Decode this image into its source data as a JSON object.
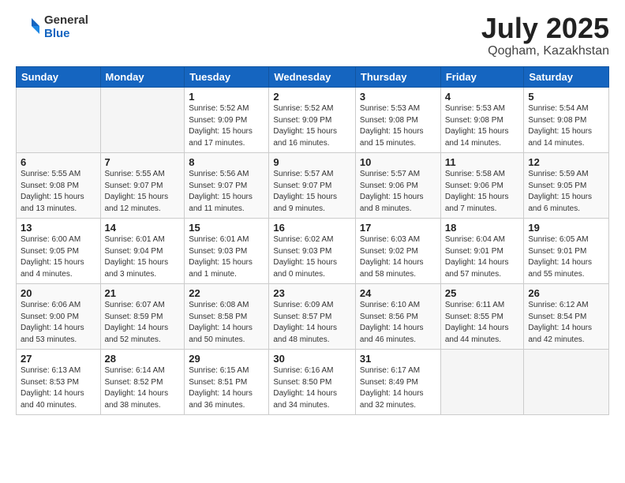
{
  "logo": {
    "general": "General",
    "blue": "Blue"
  },
  "header": {
    "month_year": "July 2025",
    "location": "Qogham, Kazakhstan"
  },
  "weekdays": [
    "Sunday",
    "Monday",
    "Tuesday",
    "Wednesday",
    "Thursday",
    "Friday",
    "Saturday"
  ],
  "weeks": [
    [
      {
        "day": "",
        "info": ""
      },
      {
        "day": "",
        "info": ""
      },
      {
        "day": "1",
        "info": "Sunrise: 5:52 AM\nSunset: 9:09 PM\nDaylight: 15 hours\nand 17 minutes."
      },
      {
        "day": "2",
        "info": "Sunrise: 5:52 AM\nSunset: 9:09 PM\nDaylight: 15 hours\nand 16 minutes."
      },
      {
        "day": "3",
        "info": "Sunrise: 5:53 AM\nSunset: 9:08 PM\nDaylight: 15 hours\nand 15 minutes."
      },
      {
        "day": "4",
        "info": "Sunrise: 5:53 AM\nSunset: 9:08 PM\nDaylight: 15 hours\nand 14 minutes."
      },
      {
        "day": "5",
        "info": "Sunrise: 5:54 AM\nSunset: 9:08 PM\nDaylight: 15 hours\nand 14 minutes."
      }
    ],
    [
      {
        "day": "6",
        "info": "Sunrise: 5:55 AM\nSunset: 9:08 PM\nDaylight: 15 hours\nand 13 minutes."
      },
      {
        "day": "7",
        "info": "Sunrise: 5:55 AM\nSunset: 9:07 PM\nDaylight: 15 hours\nand 12 minutes."
      },
      {
        "day": "8",
        "info": "Sunrise: 5:56 AM\nSunset: 9:07 PM\nDaylight: 15 hours\nand 11 minutes."
      },
      {
        "day": "9",
        "info": "Sunrise: 5:57 AM\nSunset: 9:07 PM\nDaylight: 15 hours\nand 9 minutes."
      },
      {
        "day": "10",
        "info": "Sunrise: 5:57 AM\nSunset: 9:06 PM\nDaylight: 15 hours\nand 8 minutes."
      },
      {
        "day": "11",
        "info": "Sunrise: 5:58 AM\nSunset: 9:06 PM\nDaylight: 15 hours\nand 7 minutes."
      },
      {
        "day": "12",
        "info": "Sunrise: 5:59 AM\nSunset: 9:05 PM\nDaylight: 15 hours\nand 6 minutes."
      }
    ],
    [
      {
        "day": "13",
        "info": "Sunrise: 6:00 AM\nSunset: 9:05 PM\nDaylight: 15 hours\nand 4 minutes."
      },
      {
        "day": "14",
        "info": "Sunrise: 6:01 AM\nSunset: 9:04 PM\nDaylight: 15 hours\nand 3 minutes."
      },
      {
        "day": "15",
        "info": "Sunrise: 6:01 AM\nSunset: 9:03 PM\nDaylight: 15 hours\nand 1 minute."
      },
      {
        "day": "16",
        "info": "Sunrise: 6:02 AM\nSunset: 9:03 PM\nDaylight: 15 hours\nand 0 minutes."
      },
      {
        "day": "17",
        "info": "Sunrise: 6:03 AM\nSunset: 9:02 PM\nDaylight: 14 hours\nand 58 minutes."
      },
      {
        "day": "18",
        "info": "Sunrise: 6:04 AM\nSunset: 9:01 PM\nDaylight: 14 hours\nand 57 minutes."
      },
      {
        "day": "19",
        "info": "Sunrise: 6:05 AM\nSunset: 9:01 PM\nDaylight: 14 hours\nand 55 minutes."
      }
    ],
    [
      {
        "day": "20",
        "info": "Sunrise: 6:06 AM\nSunset: 9:00 PM\nDaylight: 14 hours\nand 53 minutes."
      },
      {
        "day": "21",
        "info": "Sunrise: 6:07 AM\nSunset: 8:59 PM\nDaylight: 14 hours\nand 52 minutes."
      },
      {
        "day": "22",
        "info": "Sunrise: 6:08 AM\nSunset: 8:58 PM\nDaylight: 14 hours\nand 50 minutes."
      },
      {
        "day": "23",
        "info": "Sunrise: 6:09 AM\nSunset: 8:57 PM\nDaylight: 14 hours\nand 48 minutes."
      },
      {
        "day": "24",
        "info": "Sunrise: 6:10 AM\nSunset: 8:56 PM\nDaylight: 14 hours\nand 46 minutes."
      },
      {
        "day": "25",
        "info": "Sunrise: 6:11 AM\nSunset: 8:55 PM\nDaylight: 14 hours\nand 44 minutes."
      },
      {
        "day": "26",
        "info": "Sunrise: 6:12 AM\nSunset: 8:54 PM\nDaylight: 14 hours\nand 42 minutes."
      }
    ],
    [
      {
        "day": "27",
        "info": "Sunrise: 6:13 AM\nSunset: 8:53 PM\nDaylight: 14 hours\nand 40 minutes."
      },
      {
        "day": "28",
        "info": "Sunrise: 6:14 AM\nSunset: 8:52 PM\nDaylight: 14 hours\nand 38 minutes."
      },
      {
        "day": "29",
        "info": "Sunrise: 6:15 AM\nSunset: 8:51 PM\nDaylight: 14 hours\nand 36 minutes."
      },
      {
        "day": "30",
        "info": "Sunrise: 6:16 AM\nSunset: 8:50 PM\nDaylight: 14 hours\nand 34 minutes."
      },
      {
        "day": "31",
        "info": "Sunrise: 6:17 AM\nSunset: 8:49 PM\nDaylight: 14 hours\nand 32 minutes."
      },
      {
        "day": "",
        "info": ""
      },
      {
        "day": "",
        "info": ""
      }
    ]
  ]
}
